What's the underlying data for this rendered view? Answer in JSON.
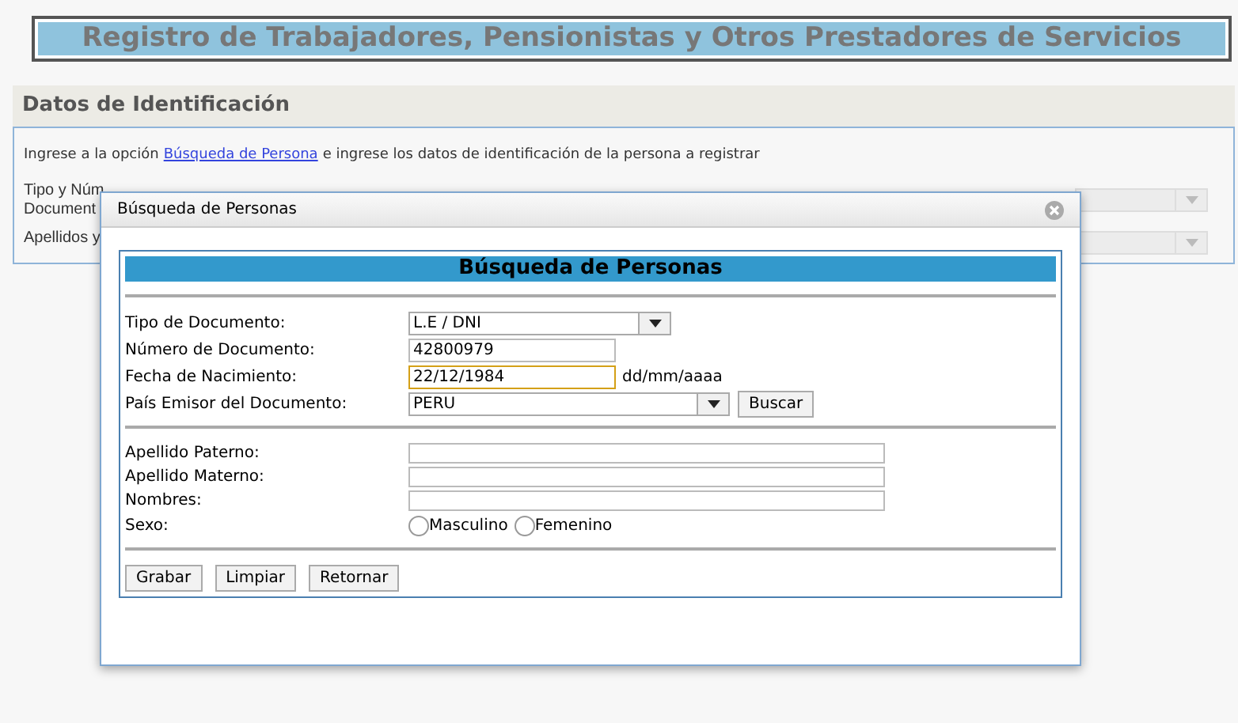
{
  "header": {
    "title": "Registro de Trabajadores, Pensionistas y Otros Prestadores de Servicios"
  },
  "section": {
    "title": "Datos de Identificación",
    "instruction": {
      "before": "Ingrese a la opción",
      "link": "Búsqueda de Persona",
      "after": "e ingrese los datos de identificación de la persona a registrar"
    },
    "background_labels": [
      {
        "lines": [
          "Tipo y Núm",
          "Document"
        ]
      },
      {
        "lines": [
          "Apellidos y"
        ]
      }
    ]
  },
  "dialog": {
    "title": "Búsqueda de Personas",
    "heading": "Búsqueda de Personas",
    "search_fields": [
      {
        "kind": "select",
        "label": "Tipo de Documento:",
        "value": "L.E / DNI",
        "focused": false
      },
      {
        "kind": "text",
        "label": "Número de Documento:",
        "value": "42800979",
        "focused": false
      },
      {
        "kind": "text",
        "label": "Fecha de Nacimiento:",
        "value": "22/12/1984",
        "focused": true,
        "hint": "dd/mm/aaaa"
      },
      {
        "kind": "select",
        "label": "País Emisor del Documento:",
        "value": "PERU",
        "focused": false,
        "button": "Buscar"
      }
    ],
    "person_fields": [
      {
        "label": "Apellido Paterno:"
      },
      {
        "label": "Apellido Materno:"
      },
      {
        "label": "Nombres:"
      }
    ],
    "sex": {
      "label": "Sexo:",
      "options": [
        {
          "label": "Masculino",
          "selected": false
        },
        {
          "label": "Femenino",
          "selected": false
        }
      ]
    },
    "buttons": [
      "Grabar",
      "Limpiar",
      "Retornar"
    ]
  }
}
